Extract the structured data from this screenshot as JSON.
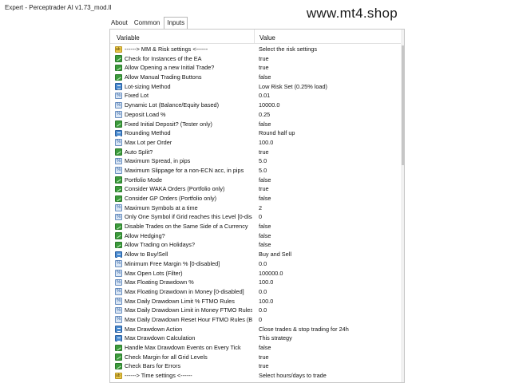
{
  "window": {
    "title": "Expert - Perceptrader AI v1.73_mod.ll"
  },
  "watermark": "www.mt4.shop",
  "tabs": [
    {
      "label": "About",
      "active": false
    },
    {
      "label": "Common",
      "active": false
    },
    {
      "label": "Inputs",
      "active": true
    }
  ],
  "table": {
    "headers": {
      "variable": "Variable",
      "value": "Value"
    },
    "rows": [
      {
        "icon": "str",
        "name": "------> MM & Risk settings <------",
        "value": "Select the risk settings"
      },
      {
        "icon": "bool",
        "name": "Check for Instances of the EA",
        "value": "true"
      },
      {
        "icon": "bool",
        "name": "Allow Opening a new Initial Trade?",
        "value": "true"
      },
      {
        "icon": "bool",
        "name": "Allow Manual Trading Buttons",
        "value": "false"
      },
      {
        "icon": "enum",
        "name": "Lot-sizing Method",
        "value": "Low Risk Set (0.25% load)"
      },
      {
        "icon": "num",
        "name": "Fixed Lot",
        "value": "0.01"
      },
      {
        "icon": "num",
        "name": "Dynamic Lot (Balance/Equity based)",
        "value": "10000.0"
      },
      {
        "icon": "num",
        "name": "Deposit Load %",
        "value": "0.25"
      },
      {
        "icon": "bool",
        "name": "Fixed Initial Deposit? (Tester only)",
        "value": "false"
      },
      {
        "icon": "enum",
        "name": "Rounding Method",
        "value": "Round half up"
      },
      {
        "icon": "num",
        "name": "Max Lot per Order",
        "value": "100.0"
      },
      {
        "icon": "bool",
        "name": "Auto Split?",
        "value": "true"
      },
      {
        "icon": "num",
        "name": "Maximum Spread, in pips",
        "value": "5.0"
      },
      {
        "icon": "num",
        "name": "Maximum Slippage for a non-ECN acc, in pips",
        "value": "5.0"
      },
      {
        "icon": "bool",
        "name": "Portfolio Mode",
        "value": "false"
      },
      {
        "icon": "bool",
        "name": "Consider WAKA Orders (Portfolio only)",
        "value": "true"
      },
      {
        "icon": "bool",
        "name": "Consider GP Orders (Portfolio only)",
        "value": "false"
      },
      {
        "icon": "num",
        "name": "Maximum Symbols at a time",
        "value": "2"
      },
      {
        "icon": "num",
        "name": "Only One Symbol if Grid reaches this Level [0-disabled]",
        "value": "0"
      },
      {
        "icon": "bool",
        "name": "Disable Trades on the Same Side of a Currency",
        "value": "false"
      },
      {
        "icon": "bool",
        "name": "Allow Hedging?",
        "value": "false"
      },
      {
        "icon": "bool",
        "name": "Allow Trading on Holidays?",
        "value": "false"
      },
      {
        "icon": "enum",
        "name": "Allow to Buy/Sell",
        "value": "Buy and Sell"
      },
      {
        "icon": "num",
        "name": "Minimum Free Margin % [0-disabled]",
        "value": "0.0"
      },
      {
        "icon": "num",
        "name": "Max Open Lots (Filter)",
        "value": "100000.0"
      },
      {
        "icon": "num",
        "name": "Max Floating Drawdown %",
        "value": "100.0"
      },
      {
        "icon": "num",
        "name": "Max Floating Drawdown in Money [0-disabled]",
        "value": "0.0"
      },
      {
        "icon": "num",
        "name": "Max Daily Drawdown Limit % FTMO Rules",
        "value": "100.0"
      },
      {
        "icon": "num",
        "name": "Max Daily Drawdown Limit in Money FTMO Rules [0-disabled]",
        "value": "0.0"
      },
      {
        "icon": "num",
        "name": "Max Daily Drawdown Reset Hour FTMO Rules (Broker time)",
        "value": "0"
      },
      {
        "icon": "enum",
        "name": "Max Drawdown Action",
        "value": "Close trades & stop trading for 24h"
      },
      {
        "icon": "enum",
        "name": "Max Drawdown Calculation",
        "value": "This strategy"
      },
      {
        "icon": "bool",
        "name": "Handle Max Drawdown Events on Every Tick",
        "value": "false"
      },
      {
        "icon": "bool",
        "name": "Check Margin for all Grid Levels",
        "value": "true"
      },
      {
        "icon": "bool",
        "name": "Check Bars for Errors",
        "value": "true"
      },
      {
        "icon": "str",
        "name": "------> Time settings <------",
        "value": "Select hours/days to trade"
      }
    ]
  }
}
